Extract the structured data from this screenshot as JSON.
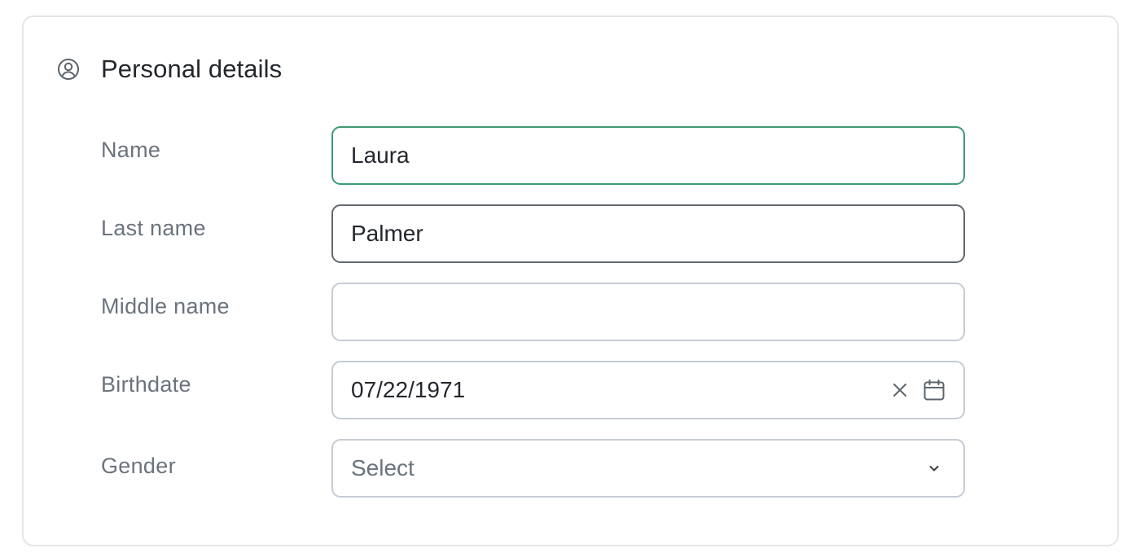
{
  "section": {
    "title": "Personal details",
    "icon": "user-circle-icon"
  },
  "fields": {
    "name": {
      "label": "Name",
      "value": "Laura",
      "placeholder": ""
    },
    "last_name": {
      "label": "Last name",
      "value": "Palmer",
      "placeholder": ""
    },
    "middle_name": {
      "label": "Middle name",
      "value": "",
      "placeholder": ""
    },
    "birthdate": {
      "label": "Birthdate",
      "value": "07/22/1971",
      "clear_icon": "close-icon",
      "calendar_icon": "calendar-icon"
    },
    "gender": {
      "label": "Gender",
      "selected": "Select",
      "icon": "chevron-down-icon"
    }
  },
  "colors": {
    "focus_border": "#3f9b73",
    "active_border": "#62686f",
    "default_border": "#c6ccd3",
    "card_border": "#e3e6ea",
    "label_text": "#6b737c",
    "value_text": "#24282d"
  }
}
